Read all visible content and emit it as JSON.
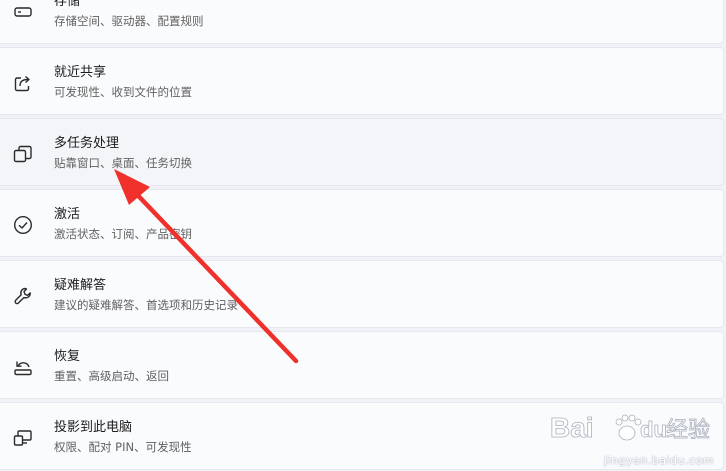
{
  "settings": {
    "items": [
      {
        "title": "存储",
        "subtitle": "存储空间、驱动器、配置规则",
        "icon": "storage-icon"
      },
      {
        "title": "就近共享",
        "subtitle": "可发现性、收到文件的位置",
        "icon": "share-icon"
      },
      {
        "title": "多任务处理",
        "subtitle": "贴靠窗口、桌面、任务切换",
        "icon": "multitasking-icon"
      },
      {
        "title": "激活",
        "subtitle": "激活状态、订阅、产品密钥",
        "icon": "activation-check-icon"
      },
      {
        "title": "疑难解答",
        "subtitle": "建议的疑难解答、首选项和历史记录",
        "icon": "wrench-icon"
      },
      {
        "title": "恢复",
        "subtitle": "重置、高级启动、返回",
        "icon": "recovery-icon"
      },
      {
        "title": "投影到此电脑",
        "subtitle": "权限、配对 PIN、可发现性",
        "icon": "project-to-pc-icon"
      }
    ]
  },
  "annotation": {
    "arrow_color": "#f0302a"
  },
  "watermark": {
    "logo_text": "Bai",
    "logo_text2": "du",
    "logo_text3": "经验",
    "sub_text": "jingyan.baidu.com"
  }
}
